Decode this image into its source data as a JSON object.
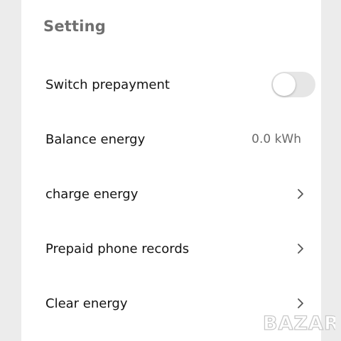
{
  "header": {
    "title": "Setting"
  },
  "settings": {
    "items": [
      {
        "label": "Switch prepayment",
        "control": "toggle",
        "toggle_on": false
      },
      {
        "label": "Balance energy",
        "value": "0.0 kWh"
      },
      {
        "label": "charge energy",
        "icon": "chevron-right-icon"
      },
      {
        "label": "Prepaid phone records",
        "icon": "chevron-right-icon"
      },
      {
        "label": "Clear energy",
        "icon": "chevron-right-icon"
      }
    ]
  },
  "watermark": {
    "text": "BAZAR"
  },
  "colors": {
    "background": "#ffffff",
    "title": "#6f6f6f",
    "text": "#141414",
    "secondary_text": "#6a6a6a",
    "toggle_track_off": "#e6e6e6",
    "chevron": "#555555"
  }
}
